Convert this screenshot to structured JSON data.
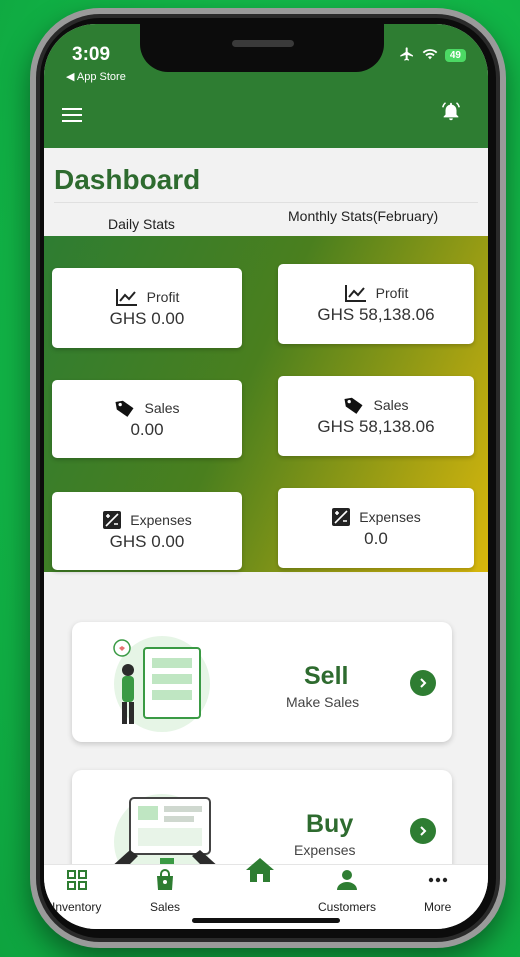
{
  "status_bar": {
    "time": "3:09",
    "back_app": "◀ App Store",
    "battery": "49"
  },
  "header": {
    "title": "Dashboard"
  },
  "tabs": {
    "daily": "Daily Stats",
    "monthly": "Monthly Stats(February)"
  },
  "daily": {
    "profit": {
      "label": "Profit",
      "value": "GHS 0.00"
    },
    "sales": {
      "label": "Sales",
      "value": "0.00"
    },
    "expenses": {
      "label": "Expenses",
      "value": "GHS 0.00"
    }
  },
  "monthly": {
    "profit": {
      "label": "Profit",
      "value": "GHS 58,138.06"
    },
    "sales": {
      "label": "Sales",
      "value": "GHS 58,138.06"
    },
    "expenses": {
      "label": "Expenses",
      "value": "0.0"
    }
  },
  "actions": {
    "sell": {
      "title": "Sell",
      "subtitle": "Make Sales"
    },
    "buy": {
      "title": "Buy",
      "subtitle": "Expenses"
    }
  },
  "nav": {
    "inventory": "Inventory",
    "sales": "Sales",
    "customers": "Customers",
    "more": "More"
  },
  "colors": {
    "primary": "#2e7d32",
    "title_green": "#2e6b2f",
    "accent_gold": "#d9b80c",
    "background": "#12b848"
  },
  "icons": [
    "menu-icon",
    "bell-icon",
    "trend-icon",
    "tag-icon",
    "expense-icon",
    "chevron-right-icon",
    "grid-icon",
    "bag-icon",
    "home-icon",
    "person-icon",
    "more-icon",
    "airplane-icon",
    "wifi-icon"
  ]
}
